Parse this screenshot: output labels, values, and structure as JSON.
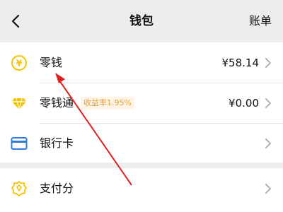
{
  "navbar": {
    "title": "钱包",
    "right_label": "账单",
    "back_icon": "chevron-left-icon"
  },
  "rows": [
    {
      "label": "零钱",
      "value": "¥58.14",
      "icon": "yuan-coin-icon",
      "icon_color": "#f5c400"
    },
    {
      "label": "零钱通",
      "badge": "收益率1.95%",
      "value": "¥0.00",
      "icon": "diamond-icon",
      "icon_color": "#f5c400"
    },
    {
      "label": "银行卡",
      "icon": "bank-card-icon",
      "icon_color": "#2f7ddb"
    },
    {
      "label": "支付分",
      "icon": "badge-score-icon",
      "icon_color": "#f5c400"
    }
  ],
  "annotation": {
    "color": "#e02020",
    "type": "red-arrow"
  }
}
